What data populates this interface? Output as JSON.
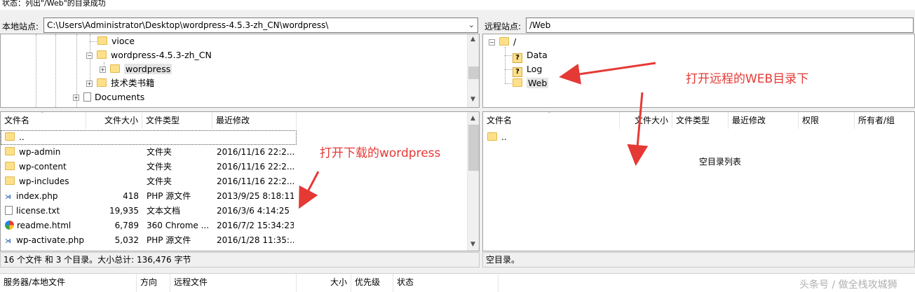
{
  "status_line": "状态：列出\"/Web\"的目录成功",
  "local": {
    "site_label": "本地站点:",
    "path": "C:\\Users\\Administrator\\Desktop\\wordpress-4.5.3-zh_CN\\wordpress\\",
    "tree": [
      {
        "label": "vioce"
      },
      {
        "label": "wordpress-4.5.3-zh_CN",
        "expander": "−"
      },
      {
        "label": "wordpress",
        "expander": "+",
        "selected": true
      },
      {
        "label": "技术类书籍",
        "expander": "+"
      },
      {
        "label": "Documents",
        "expander": "+"
      }
    ],
    "columns": [
      "文件名",
      "文件大小",
      "文件类型",
      "最近修改"
    ],
    "files": [
      {
        "name": "..",
        "size": "",
        "type": "",
        "modified": "",
        "icon": "folder-icon"
      },
      {
        "name": "wp-admin",
        "size": "",
        "type": "文件夹",
        "modified": "2016/11/16 22:2...",
        "icon": "folder-icon"
      },
      {
        "name": "wp-content",
        "size": "",
        "type": "文件夹",
        "modified": "2016/11/16 22:2...",
        "icon": "folder-icon"
      },
      {
        "name": "wp-includes",
        "size": "",
        "type": "文件夹",
        "modified": "2016/11/16 22:2...",
        "icon": "folder-icon"
      },
      {
        "name": "index.php",
        "size": "418",
        "type": "PHP 源文件",
        "modified": "2013/9/25 8:18:11",
        "icon": "php-file-icon"
      },
      {
        "name": "license.txt",
        "size": "19,935",
        "type": "文本文档",
        "modified": "2016/3/6 4:14:25",
        "icon": "text-file-icon"
      },
      {
        "name": "readme.html",
        "size": "6,789",
        "type": "360 Chrome ...",
        "modified": "2016/7/2 15:34:23",
        "icon": "chrome-file-icon"
      },
      {
        "name": "wp-activate.php",
        "size": "5,032",
        "type": "PHP 源文件",
        "modified": "2016/1/28 11:35:...",
        "icon": "php-file-icon"
      }
    ],
    "status": "16 个文件 和 3 个目录。大小总计: 136,476 字节"
  },
  "remote": {
    "site_label": "远程站点:",
    "path": "/Web",
    "tree": [
      {
        "label": "/",
        "expander": "−"
      },
      {
        "label": "Data",
        "icon": "question-folder-icon"
      },
      {
        "label": "Log",
        "icon": "question-folder-icon"
      },
      {
        "label": "Web",
        "icon": "folder-icon",
        "selected": true
      }
    ],
    "columns": [
      "文件名",
      "文件大小",
      "文件类型",
      "最近修改",
      "权限",
      "所有者/组"
    ],
    "files": [
      {
        "name": "..",
        "icon": "folder-icon"
      }
    ],
    "empty_message": "空目录列表",
    "status": "空目录。"
  },
  "queue_columns": [
    "服务器/本地文件",
    "方向",
    "远程文件",
    "大小",
    "优先级",
    "状态"
  ],
  "annotations": {
    "remote": "打开远程的WEB目录下",
    "local": "打开下载的wordpress"
  },
  "watermark": "头条号 / 做全栈攻城狮",
  "colors": {
    "annotation": "#e53935",
    "folder": "#ffe08a"
  }
}
